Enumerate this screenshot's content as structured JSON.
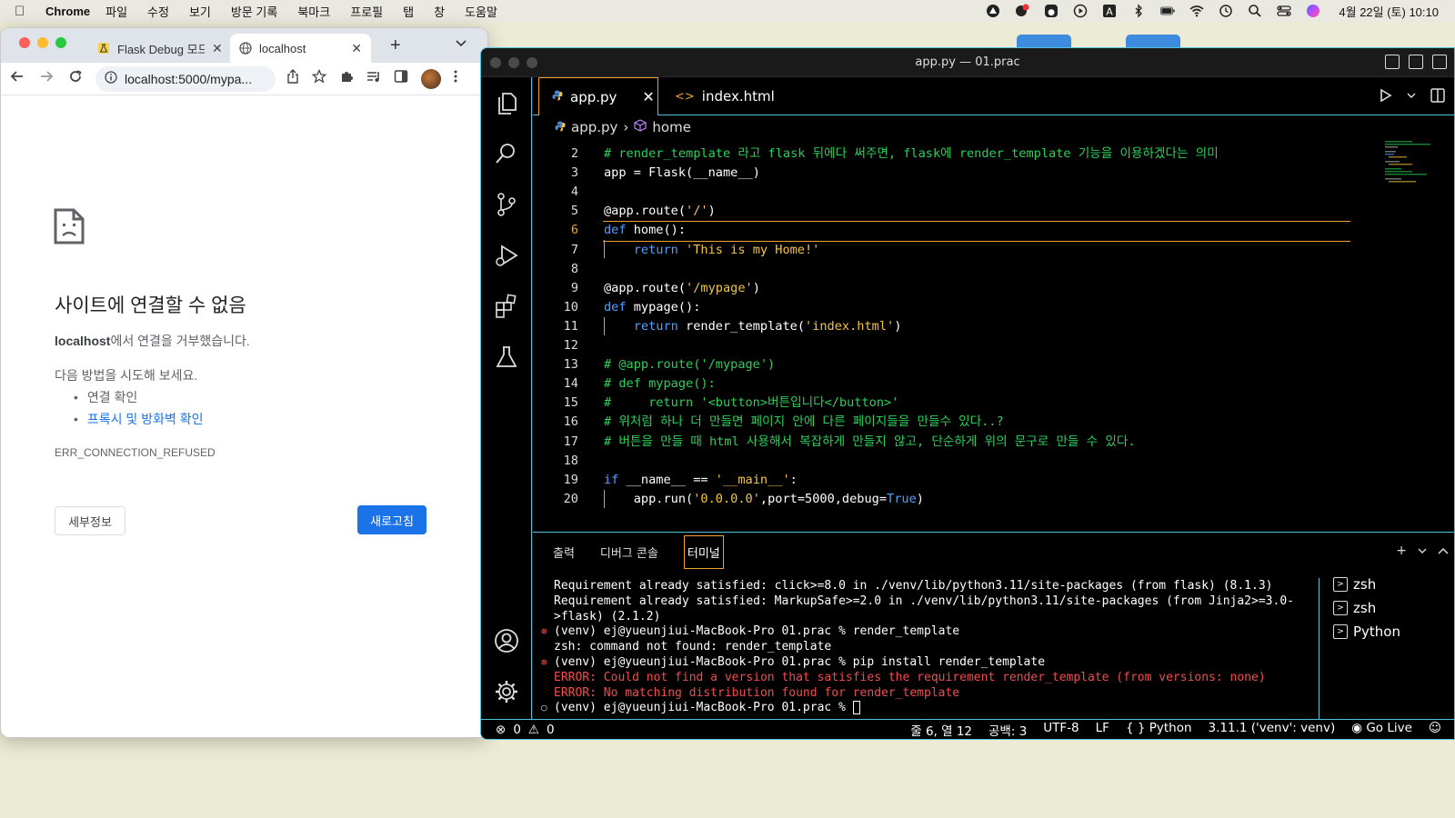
{
  "menubar": {
    "app": "Chrome",
    "items": [
      "파일",
      "수정",
      "보기",
      "방문 기록",
      "북마크",
      "프로필",
      "탭",
      "창",
      "도움말"
    ],
    "clock": "4월 22일 (토)  10:10"
  },
  "chrome": {
    "tabs": [
      {
        "title": "Flask Debug 모드",
        "icon": "flask-icon"
      },
      {
        "title": "localhost",
        "icon": "globe-icon"
      }
    ],
    "url": "localhost:5000/mypa...",
    "error": {
      "title": "사이트에 연결할 수 없음",
      "host": "localhost",
      "desc_suffix": "에서 연결을 거부했습니다.",
      "try_title": "다음 방법을 시도해 보세요.",
      "try_items": [
        "연결 확인",
        "프록시 및 방화벽 확인"
      ],
      "code": "ERR_CONNECTION_REFUSED",
      "details_label": "세부정보",
      "reload_label": "새로고침"
    }
  },
  "vscode": {
    "title": "app.py — 01.prac",
    "tabs": [
      {
        "label": "app.py",
        "icon": "python-icon"
      },
      {
        "label": "index.html",
        "icon": "html-icon"
      }
    ],
    "breadcrumb": [
      "app.py",
      "home"
    ],
    "code_lines": [
      {
        "n": "2",
        "text": "# render_template 라고 flask 뒤에다 써주면, flask에 render_template 기능을 이용하겠다는 의미"
      },
      {
        "n": "3",
        "text": "app = Flask(__name__)"
      },
      {
        "n": "4",
        "text": ""
      },
      {
        "n": "5",
        "text": "@app.route('/')"
      },
      {
        "n": "6",
        "text": "def home():"
      },
      {
        "n": "7",
        "text": "    return 'This is my Home!'"
      },
      {
        "n": "8",
        "text": ""
      },
      {
        "n": "9",
        "text": "@app.route('/mypage')"
      },
      {
        "n": "10",
        "text": "def mypage():"
      },
      {
        "n": "11",
        "text": "    return render_template('index.html')"
      },
      {
        "n": "12",
        "text": ""
      },
      {
        "n": "13",
        "text": "# @app.route('/mypage')"
      },
      {
        "n": "14",
        "text": "# def mypage():"
      },
      {
        "n": "15",
        "text": "#     return '<button>버튼입니다</button>'"
      },
      {
        "n": "16",
        "text": "# 위처럼 하나 더 만들면 페이지 안에 다른 페이지들을 만들수 있다..?"
      },
      {
        "n": "17",
        "text": "# 버튼을 만들 때 html 사용해서 복잡하게 만들지 않고, 단순하게 위의 문구로 만들 수 있다."
      },
      {
        "n": "18",
        "text": ""
      },
      {
        "n": "19",
        "text": "if __name__ == '__main__':"
      },
      {
        "n": "20",
        "text": "    app.run('0.0.0.0',port=5000,debug=True)"
      }
    ],
    "panel_tabs": [
      "출력",
      "디버그 콘솔",
      "터미널"
    ],
    "terminal_lines": [
      {
        "text": "Requirement already satisfied: click>=8.0 in ./venv/lib/python3.11/site-packages (from flask) (8.1.3)",
        "kind": "out"
      },
      {
        "text": "Requirement already satisfied: MarkupSafe>=2.0 in ./venv/lib/python3.11/site-packages (from Jinja2>=3.0-",
        "kind": "out"
      },
      {
        "text": ">flask) (2.1.2)",
        "kind": "out"
      },
      {
        "text": "(venv) ej@yueunjiui-MacBook-Pro 01.prac % render_template",
        "kind": "cmd-fail"
      },
      {
        "text": "zsh: command not found: render_template",
        "kind": "out"
      },
      {
        "text": "(venv) ej@yueunjiui-MacBook-Pro 01.prac % pip install render_template",
        "kind": "cmd-fail"
      },
      {
        "text": "ERROR: Could not find a version that satisfies the requirement render_template (from versions: none)",
        "kind": "err"
      },
      {
        "text": "ERROR: No matching distribution found for render_template",
        "kind": "err"
      },
      {
        "text": "(venv) ej@yueunjiui-MacBook-Pro 01.prac % ",
        "kind": "prompt"
      }
    ],
    "terminals": [
      "zsh",
      "zsh",
      "Python"
    ],
    "status": {
      "errors": "0",
      "warnings": "0",
      "position": "줄 6, 열 12",
      "spaces": "공백: 3",
      "encoding": "UTF-8",
      "eol": "LF",
      "language": "Python",
      "interpreter": "3.11.1 ('venv': venv)",
      "golive": "Go Live"
    }
  }
}
